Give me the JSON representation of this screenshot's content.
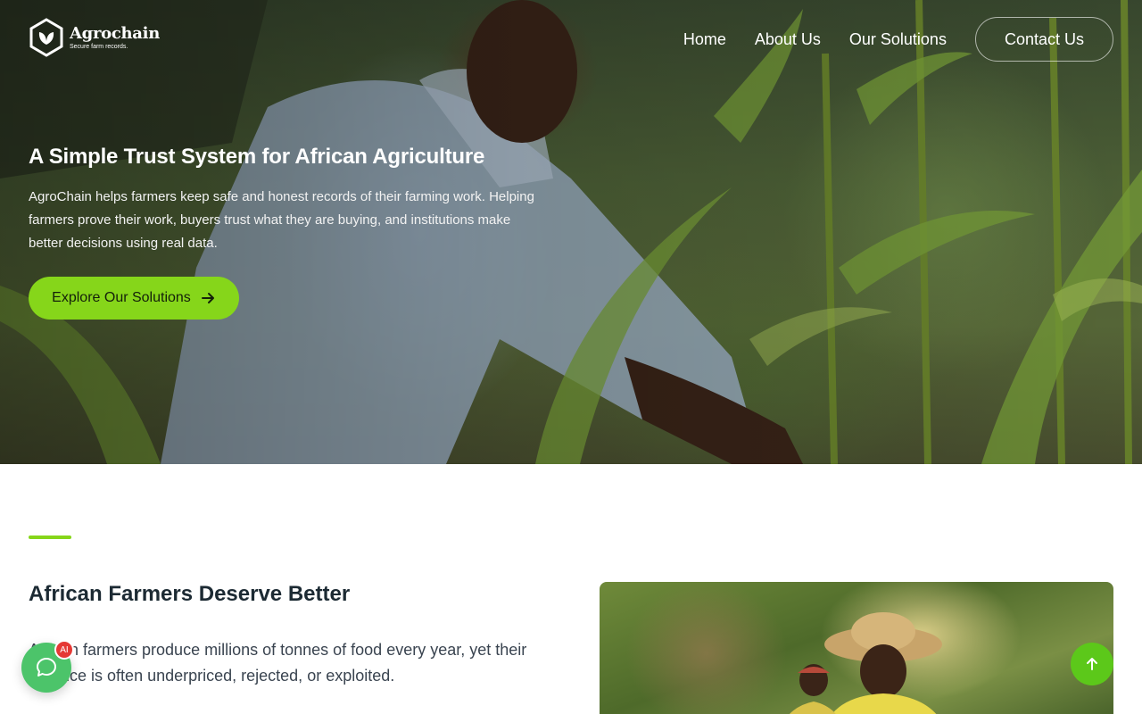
{
  "brand": {
    "name": "Agrochain",
    "tagline": "Secure farm records."
  },
  "nav": {
    "items": [
      "Home",
      "About Us",
      "Our Solutions"
    ],
    "contact": "Contact Us"
  },
  "hero": {
    "title": "A Simple Trust System for African Agriculture",
    "description": "AgroChain helps farmers keep safe and honest records of their farming work. Helping farmers prove their work, buyers trust what they are buying, and institutions make better decisions using real data.",
    "cta": "Explore Our Solutions"
  },
  "section": {
    "title": "African Farmers Deserve Better",
    "body": "African farmers produce millions of tonnes of food every year, yet their produce is often underpriced, rejected, or exploited."
  },
  "widgets": {
    "ai_badge": "AI"
  },
  "colors": {
    "accent": "#86d61a",
    "chat": "#4cc46a",
    "badge": "#e53935"
  },
  "icons": {
    "logo": "leaf-hexagon-icon",
    "cta_arrow": "arrow-right-icon",
    "chat": "chat-bubble-icon",
    "scroll_top": "arrow-up-icon"
  }
}
